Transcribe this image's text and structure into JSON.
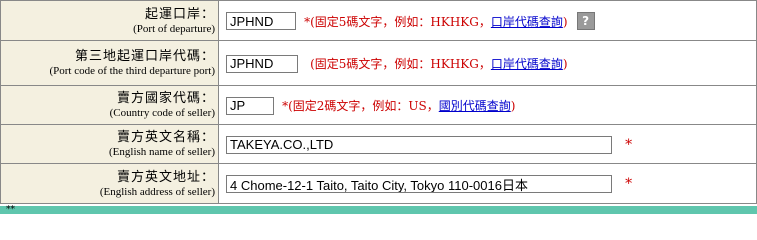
{
  "rows": [
    {
      "label_zh": "起運口岸：",
      "label_en": "(Port of departure)",
      "value": "JPHND",
      "hint_prefix": "*(固定5碼文字，例如：HKHKG，",
      "link": "口岸代碼查詢",
      "hint_suffix": ")",
      "help": "?"
    },
    {
      "label_zh": "第三地起運口岸代碼：",
      "label_en": "(Port code of the third departure port)",
      "value": "JPHND",
      "hint_prefix": "(固定5碼文字，例如：HKHKG，",
      "link": "口岸代碼查詢",
      "hint_suffix": ")"
    },
    {
      "label_zh": "賣方國家代碼：",
      "label_en": "(Country code of seller)",
      "value": "JP",
      "hint_prefix": "*(固定2碼文字，例如：US，",
      "link": "國別代碼查詢",
      "hint_suffix": ")"
    },
    {
      "label_zh": "賣方英文名稱：",
      "label_en": "(English name of seller)",
      "value": "TAKEYA.CO.,LTD",
      "star": "*"
    },
    {
      "label_zh": "賣方英文地址：",
      "label_en": "(English address of seller)",
      "value": "4 Chome-12-1 Taito, Taito City, Tokyo 110-0016日本",
      "star": "*"
    }
  ],
  "bottom_mark": "**"
}
